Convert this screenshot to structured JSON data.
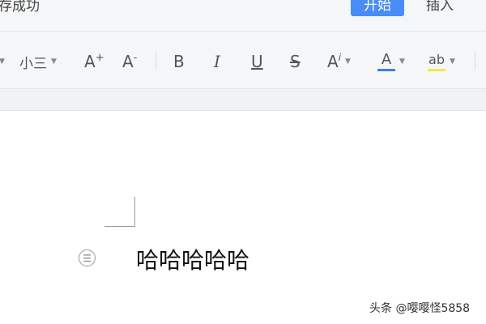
{
  "titlebar": {
    "status_text": "存成功",
    "tabs": [
      {
        "label": "开始",
        "active": true
      },
      {
        "label": "插入",
        "active": false
      }
    ],
    "accent_color": "#4a8cf5"
  },
  "toolbar": {
    "font_size": {
      "value": "小三"
    },
    "increase_font": {
      "label": "A",
      "sup": "+"
    },
    "decrease_font": {
      "label": "A",
      "sup": "-"
    },
    "bold": {
      "label": "B"
    },
    "italic": {
      "label": "I"
    },
    "underline": {
      "label": "U"
    },
    "strike": {
      "label": "S"
    },
    "text_effect": {
      "label": "A",
      "sup": "i"
    },
    "font_color": {
      "label": "A",
      "underline_color": "#3f7cf0"
    },
    "highlight": {
      "label": "ab",
      "underline_color": "#f5e642"
    }
  },
  "document": {
    "body_text": "哈哈哈哈哈"
  },
  "watermark": {
    "text": "头条 @嘤嘤怪5858"
  }
}
